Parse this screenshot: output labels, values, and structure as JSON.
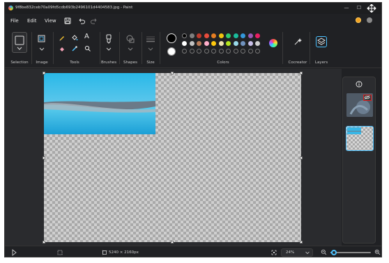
{
  "window": {
    "title": "9f8be832ceb70a09fd5cdb693b2496101d4404583.jpg - Paint",
    "minimize": "—",
    "maximize": "☐"
  },
  "menu": {
    "file": "File",
    "edit": "Edit",
    "view": "View"
  },
  "ribbon": {
    "selection_label": "Selection",
    "image_label": "Image",
    "tools_label": "Tools",
    "brushes_label": "Brushes",
    "shapes_label": "Shapes",
    "size_label": "Size",
    "colors_label": "Colors",
    "cocreator_label": "Cocreator",
    "layers_label": "Layers",
    "text_tool_glyph": "A"
  },
  "palette": {
    "row1": [
      "#000000",
      "#7f7f7f",
      "#c0392b",
      "#e74c3c",
      "#e67e22",
      "#f1c40f",
      "#2ecc71",
      "#1abc9c",
      "#3498db",
      "#9b59b6",
      "#e91e63"
    ],
    "row2": [
      "#ffffff",
      "#c3c3c3",
      "#b97a57",
      "#ffaec9",
      "#ffc90e",
      "#efe4b0",
      "#b5e61d",
      "#99d9ea",
      "#7092be",
      "#c8bfe7",
      "#d0d0d0"
    ],
    "primary": "#000000",
    "secondary": "#ffffff"
  },
  "status": {
    "dimensions": "5240 × 2160px",
    "zoom": "24%"
  },
  "zoom_slider": {
    "value_fraction": 0.08
  },
  "colors": {
    "accent": "#4cc2ff",
    "highlight_red": "#e02020"
  }
}
